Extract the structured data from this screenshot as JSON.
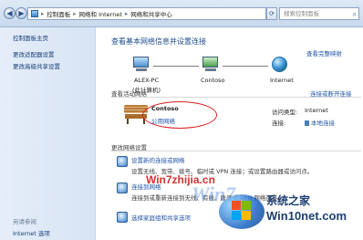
{
  "address_bar": {
    "breadcrumb": [
      "控制面板",
      "网络和 Internet",
      "网络和共享中心"
    ]
  },
  "search": {
    "placeholder": "搜索控制面板"
  },
  "sidebar": {
    "items": [
      {
        "label": "控制面板主页"
      },
      {
        "label": "更改适配器设置"
      },
      {
        "label": "更改高级共享设置"
      }
    ],
    "see_also": {
      "heading": "另请参阅",
      "items": [
        {
          "label": "Internet 选项"
        }
      ]
    }
  },
  "main": {
    "heading": "查看基本网络信息并设置连接",
    "see_full_map": "查看完整映射",
    "network_map": {
      "computer": "ALEX-PC",
      "computer_note": "(此计算机)",
      "network": "Contoso",
      "internet": "Internet"
    },
    "active_networks": {
      "heading": "查看活动网络",
      "connect_disconnect": "连接或断开连接",
      "name": "Contoso",
      "type": "公用网络",
      "access_type_label": "访问类型:",
      "access_type_value": "Internet",
      "connections_label": "连接:",
      "connections_value": "本地连接"
    },
    "change_settings": {
      "heading": "更改网络设置",
      "tasks": [
        {
          "title": "设置新的连接或网络",
          "desc": [
            "设置无线、宽带、拨号、临时或 VPN 连接；或设置路由器或访问点。"
          ]
        },
        {
          "title": "连接到网络",
          "desc": [
            "连接到或重新连接到无线、有线、拨号或 VPN 网络连接。"
          ]
        },
        {
          "title": "选择家庭组和共享选项",
          "desc": []
        }
      ]
    }
  },
  "watermarks": {
    "site_red": "Win7zhijia.cn",
    "site_blue": "Win10net.com",
    "brand": "系统之家"
  },
  "colors": {
    "link": "#1f55a8",
    "heading": "#1e4e8c",
    "sidebar_bg": "#dfe9f6",
    "highlight_ring": "#d62020"
  }
}
